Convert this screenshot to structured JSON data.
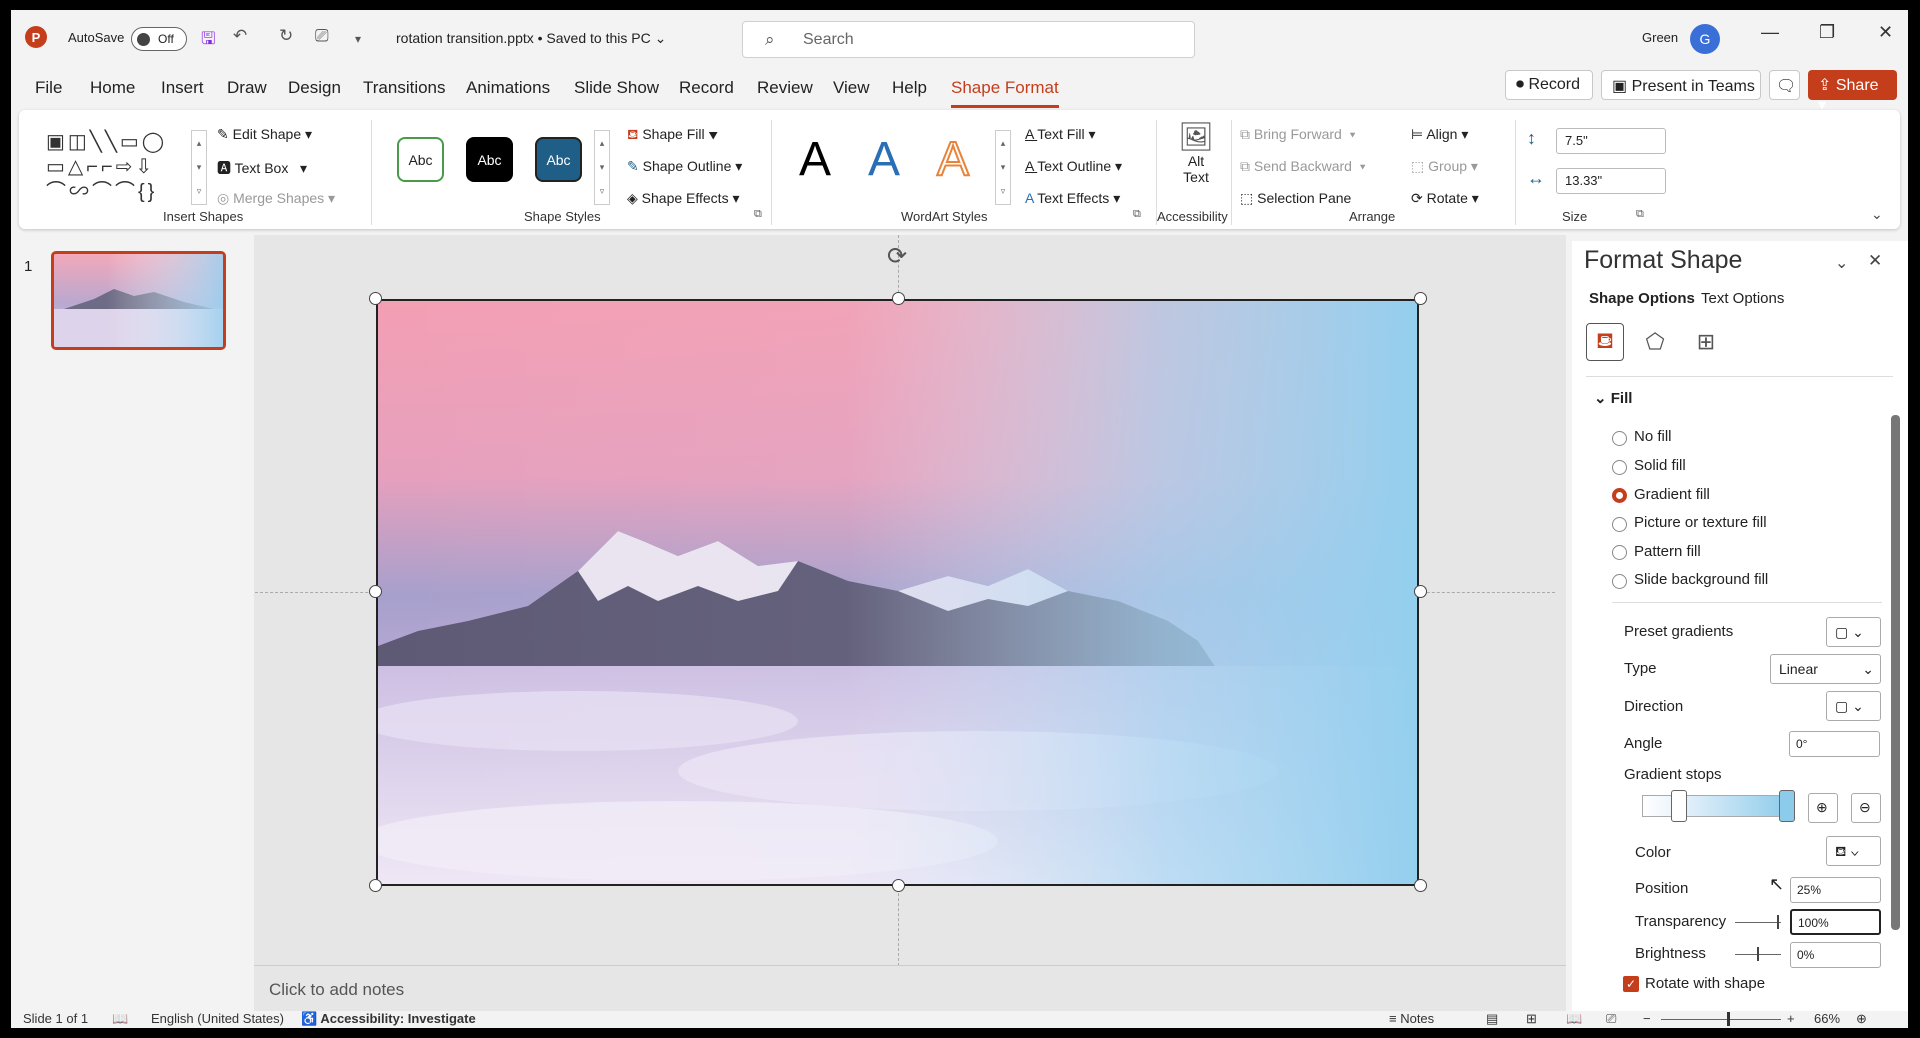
{
  "titlebar": {
    "app_logo": "P",
    "autosave_label": "AutoSave",
    "autosave_state": "Off",
    "doc_title": "rotation transition.pptx • Saved to this PC ⌄",
    "search_placeholder": "Search",
    "user_name": "Green",
    "user_initial": "G"
  },
  "menu": {
    "items": [
      "File",
      "Home",
      "Insert",
      "Draw",
      "Design",
      "Transitions",
      "Animations",
      "Slide Show",
      "Record",
      "Review",
      "View",
      "Help",
      "Shape Format"
    ],
    "active": "Shape Format",
    "record_btn": "Record",
    "teams_btn": "Present in Teams",
    "share_btn": "Share"
  },
  "ribbon": {
    "insert_shapes": {
      "label": "Insert Shapes",
      "edit_shape": "Edit Shape",
      "text_box": "Text Box",
      "merge_shapes": "Merge Shapes"
    },
    "shape_styles": {
      "label": "Shape Styles",
      "style1": "Abc",
      "style2": "Abc",
      "style3": "Abc",
      "shape_fill": "Shape Fill",
      "shape_outline": "Shape Outline",
      "shape_effects": "Shape Effects"
    },
    "wordart": {
      "label": "WordArt Styles",
      "a1": "A",
      "a2": "A",
      "a3": "A",
      "text_fill": "Text Fill",
      "text_outline": "Text Outline",
      "text_effects": "Text Effects"
    },
    "accessibility": {
      "label": "Accessibility",
      "alt_text_1": "Alt",
      "alt_text_2": "Text"
    },
    "arrange": {
      "label": "Arrange",
      "bring_forward": "Bring Forward",
      "send_backward": "Send Backward",
      "selection_pane": "Selection Pane",
      "align": "Align",
      "group": "Group",
      "rotate": "Rotate"
    },
    "size": {
      "label": "Size",
      "height": "7.5\"",
      "width": "13.33\""
    }
  },
  "slides": {
    "number": "1"
  },
  "notes_placeholder": "Click to add notes",
  "panel": {
    "title": "Format Shape",
    "tab_shape": "Shape Options",
    "tab_text": "Text Options",
    "fill_section": "Fill",
    "fill_options": [
      "No fill",
      "Solid fill",
      "Gradient fill",
      "Picture or texture fill",
      "Pattern fill",
      "Slide background fill"
    ],
    "selected_fill": "Gradient fill",
    "preset_gradients": "Preset gradients",
    "type_label": "Type",
    "type_value": "Linear",
    "direction_label": "Direction",
    "angle_label": "Angle",
    "angle_value": "0°",
    "gradient_stops": "Gradient stops",
    "color_label": "Color",
    "position_label": "Position",
    "position_value": "25%",
    "transparency_label": "Transparency",
    "transparency_value": "100%",
    "brightness_label": "Brightness",
    "brightness_value": "0%",
    "rotate_with_shape": "Rotate with shape"
  },
  "statusbar": {
    "slide_info": "Slide 1 of 1",
    "language": "English (United States)",
    "accessibility": "Accessibility: Investigate",
    "notes": "Notes",
    "zoom": "66%"
  },
  "colors": {
    "accent": "#c43e1c",
    "slide_pink": "#f0a3b6",
    "slide_blue": "#96d0f0"
  }
}
